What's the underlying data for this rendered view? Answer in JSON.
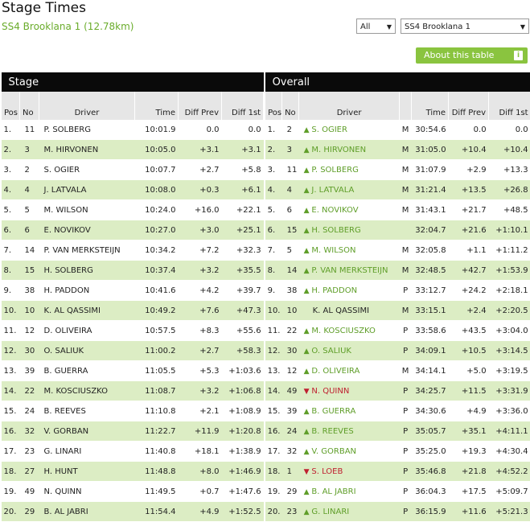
{
  "page": {
    "title": "Stage Times",
    "subtitle": "SS4 Brooklana 1 (12.78km)",
    "filter_select": "All",
    "stage_select": "SS4 Brooklana 1",
    "about_button": "About this table",
    "about_icon": "info-icon"
  },
  "sections": {
    "stage": "Stage",
    "overall": "Overall"
  },
  "columns": {
    "pos": "Pos",
    "no": "No",
    "driver": "Driver",
    "time": "Time",
    "diff_prev": "Diff Prev",
    "diff_1st": "Diff 1st"
  },
  "colors": {
    "accent": "#8ac43f",
    "up": "#5f9e29",
    "down": "#bf2030",
    "row_alt": "#dcedc4",
    "header": "#0a0a0a"
  },
  "stage_rows": [
    {
      "pos": "1.",
      "no": "11",
      "driver": "P. SOLBERG",
      "time": "10:01.9",
      "diff_prev": "0.0",
      "diff_1st": "0.0"
    },
    {
      "pos": "2.",
      "no": "3",
      "driver": "M. HIRVONEN",
      "time": "10:05.0",
      "diff_prev": "+3.1",
      "diff_1st": "+3.1"
    },
    {
      "pos": "3.",
      "no": "2",
      "driver": "S. OGIER",
      "time": "10:07.7",
      "diff_prev": "+2.7",
      "diff_1st": "+5.8"
    },
    {
      "pos": "4.",
      "no": "4",
      "driver": "J. LATVALA",
      "time": "10:08.0",
      "diff_prev": "+0.3",
      "diff_1st": "+6.1"
    },
    {
      "pos": "5.",
      "no": "5",
      "driver": "M. WILSON",
      "time": "10:24.0",
      "diff_prev": "+16.0",
      "diff_1st": "+22.1"
    },
    {
      "pos": "6.",
      "no": "6",
      "driver": "E. NOVIKOV",
      "time": "10:27.0",
      "diff_prev": "+3.0",
      "diff_1st": "+25.1"
    },
    {
      "pos": "7.",
      "no": "14",
      "driver": "P. VAN MERKSTEIJN",
      "time": "10:34.2",
      "diff_prev": "+7.2",
      "diff_1st": "+32.3"
    },
    {
      "pos": "8.",
      "no": "15",
      "driver": "H. SOLBERG",
      "time": "10:37.4",
      "diff_prev": "+3.2",
      "diff_1st": "+35.5"
    },
    {
      "pos": "9.",
      "no": "38",
      "driver": "H. PADDON",
      "time": "10:41.6",
      "diff_prev": "+4.2",
      "diff_1st": "+39.7"
    },
    {
      "pos": "10.",
      "no": "10",
      "driver": "K. AL QASSIMI",
      "time": "10:49.2",
      "diff_prev": "+7.6",
      "diff_1st": "+47.3"
    },
    {
      "pos": "11.",
      "no": "12",
      "driver": "D. OLIVEIRA",
      "time": "10:57.5",
      "diff_prev": "+8.3",
      "diff_1st": "+55.6"
    },
    {
      "pos": "12.",
      "no": "30",
      "driver": "O. SALIUK",
      "time": "11:00.2",
      "diff_prev": "+2.7",
      "diff_1st": "+58.3"
    },
    {
      "pos": "13.",
      "no": "39",
      "driver": "B. GUERRA",
      "time": "11:05.5",
      "diff_prev": "+5.3",
      "diff_1st": "+1:03.6"
    },
    {
      "pos": "14.",
      "no": "22",
      "driver": "M. KOSCIUSZKO",
      "time": "11:08.7",
      "diff_prev": "+3.2",
      "diff_1st": "+1:06.8"
    },
    {
      "pos": "15.",
      "no": "24",
      "driver": "B. REEVES",
      "time": "11:10.8",
      "diff_prev": "+2.1",
      "diff_1st": "+1:08.9"
    },
    {
      "pos": "16.",
      "no": "32",
      "driver": "V. GORBAN",
      "time": "11:22.7",
      "diff_prev": "+11.9",
      "diff_1st": "+1:20.8"
    },
    {
      "pos": "17.",
      "no": "23",
      "driver": "G. LINARI",
      "time": "11:40.8",
      "diff_prev": "+18.1",
      "diff_1st": "+1:38.9"
    },
    {
      "pos": "18.",
      "no": "27",
      "driver": "H. HUNT",
      "time": "11:48.8",
      "diff_prev": "+8.0",
      "diff_1st": "+1:46.9"
    },
    {
      "pos": "19.",
      "no": "49",
      "driver": "N. QUINN",
      "time": "11:49.5",
      "diff_prev": "+0.7",
      "diff_1st": "+1:47.6"
    },
    {
      "pos": "20.",
      "no": "29",
      "driver": "B. AL JABRI",
      "time": "11:54.4",
      "diff_prev": "+4.9",
      "diff_1st": "+1:52.5"
    }
  ],
  "overall_rows": [
    {
      "pos": "1.",
      "no": "2",
      "trend": "up",
      "driver": "S. OGIER",
      "mark": "M",
      "time": "30:54.6",
      "diff_prev": "0.0",
      "diff_1st": "0.0"
    },
    {
      "pos": "2.",
      "no": "3",
      "trend": "up",
      "driver": "M. HIRVONEN",
      "mark": "M",
      "time": "31:05.0",
      "diff_prev": "+10.4",
      "diff_1st": "+10.4"
    },
    {
      "pos": "3.",
      "no": "11",
      "trend": "up",
      "driver": "P. SOLBERG",
      "mark": "M",
      "time": "31:07.9",
      "diff_prev": "+2.9",
      "diff_1st": "+13.3"
    },
    {
      "pos": "4.",
      "no": "4",
      "trend": "up",
      "driver": "J. LATVALA",
      "mark": "M",
      "time": "31:21.4",
      "diff_prev": "+13.5",
      "diff_1st": "+26.8"
    },
    {
      "pos": "5.",
      "no": "6",
      "trend": "up",
      "driver": "E. NOVIKOV",
      "mark": "M",
      "time": "31:43.1",
      "diff_prev": "+21.7",
      "diff_1st": "+48.5"
    },
    {
      "pos": "6.",
      "no": "15",
      "trend": "up",
      "driver": "H. SOLBERG",
      "mark": "",
      "time": "32:04.7",
      "diff_prev": "+21.6",
      "diff_1st": "+1:10.1"
    },
    {
      "pos": "7.",
      "no": "5",
      "trend": "up",
      "driver": "M. WILSON",
      "mark": "M",
      "time": "32:05.8",
      "diff_prev": "+1.1",
      "diff_1st": "+1:11.2"
    },
    {
      "pos": "8.",
      "no": "14",
      "trend": "up",
      "driver": "P. VAN MERKSTEIJN",
      "mark": "M",
      "time": "32:48.5",
      "diff_prev": "+42.7",
      "diff_1st": "+1:53.9"
    },
    {
      "pos": "9.",
      "no": "38",
      "trend": "up",
      "driver": "H. PADDON",
      "mark": "P",
      "time": "33:12.7",
      "diff_prev": "+24.2",
      "diff_1st": "+2:18.1"
    },
    {
      "pos": "10.",
      "no": "10",
      "trend": "",
      "driver": "K. AL QASSIMI",
      "mark": "M",
      "time": "33:15.1",
      "diff_prev": "+2.4",
      "diff_1st": "+2:20.5"
    },
    {
      "pos": "11.",
      "no": "22",
      "trend": "up",
      "driver": "M. KOSCIUSZKO",
      "mark": "P",
      "time": "33:58.6",
      "diff_prev": "+43.5",
      "diff_1st": "+3:04.0"
    },
    {
      "pos": "12.",
      "no": "30",
      "trend": "up",
      "driver": "O. SALIUK",
      "mark": "P",
      "time": "34:09.1",
      "diff_prev": "+10.5",
      "diff_1st": "+3:14.5"
    },
    {
      "pos": "13.",
      "no": "12",
      "trend": "up",
      "driver": "D. OLIVEIRA",
      "mark": "M",
      "time": "34:14.1",
      "diff_prev": "+5.0",
      "diff_1st": "+3:19.5"
    },
    {
      "pos": "14.",
      "no": "49",
      "trend": "down",
      "driver": "N. QUINN",
      "mark": "P",
      "time": "34:25.7",
      "diff_prev": "+11.5",
      "diff_1st": "+3:31.9"
    },
    {
      "pos": "15.",
      "no": "39",
      "trend": "up",
      "driver": "B. GUERRA",
      "mark": "P",
      "time": "34:30.6",
      "diff_prev": "+4.9",
      "diff_1st": "+3:36.0"
    },
    {
      "pos": "16.",
      "no": "24",
      "trend": "up",
      "driver": "B. REEVES",
      "mark": "P",
      "time": "35:05.7",
      "diff_prev": "+35.1",
      "diff_1st": "+4:11.1"
    },
    {
      "pos": "17.",
      "no": "32",
      "trend": "up",
      "driver": "V. GORBAN",
      "mark": "P",
      "time": "35:25.0",
      "diff_prev": "+19.3",
      "diff_1st": "+4:30.4"
    },
    {
      "pos": "18.",
      "no": "1",
      "trend": "down",
      "driver": "S. LOEB",
      "mark": "P",
      "time": "35:46.8",
      "diff_prev": "+21.8",
      "diff_1st": "+4:52.2"
    },
    {
      "pos": "19.",
      "no": "29",
      "trend": "up",
      "driver": "B. AL JABRI",
      "mark": "P",
      "time": "36:04.3",
      "diff_prev": "+17.5",
      "diff_1st": "+5:09.7"
    },
    {
      "pos": "20.",
      "no": "23",
      "trend": "up",
      "driver": "G. LINARI",
      "mark": "P",
      "time": "36:15.9",
      "diff_prev": "+11.6",
      "diff_1st": "+5:21.3"
    }
  ]
}
